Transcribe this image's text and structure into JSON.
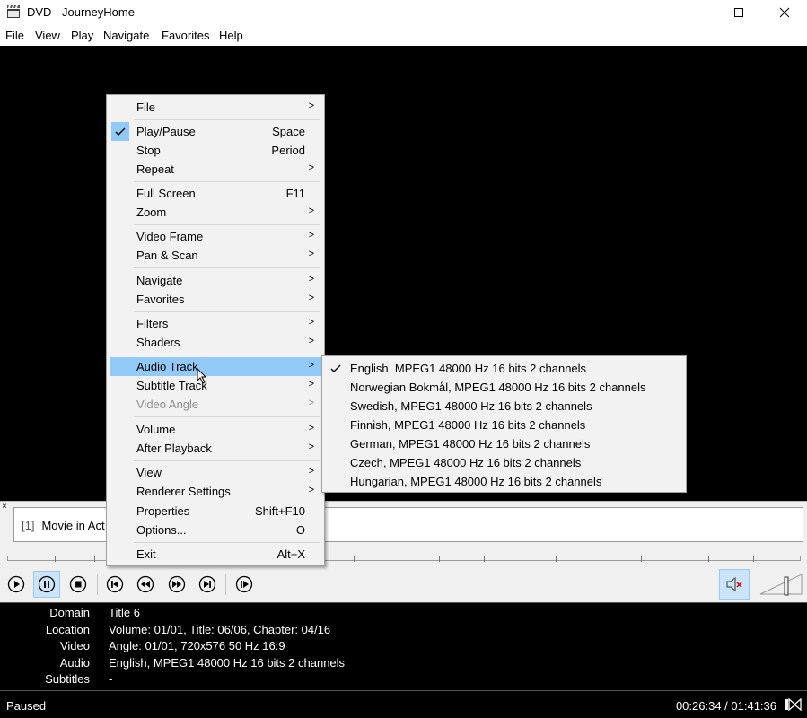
{
  "window": {
    "title": "DVD - JourneyHome"
  },
  "menubar": [
    "File",
    "View",
    "Play",
    "Navigate",
    "Favorites",
    "Help"
  ],
  "context_menu": {
    "items": [
      {
        "label": "File",
        "submenu": true
      },
      {
        "label": "Play/Pause",
        "shortcut": "Space",
        "checked": true
      },
      {
        "label": "Stop",
        "shortcut": "Period"
      },
      {
        "label": "Repeat",
        "submenu": true
      },
      {
        "label": "Full Screen",
        "shortcut": "F11"
      },
      {
        "label": "Zoom",
        "submenu": true
      },
      {
        "label": "Video Frame",
        "submenu": true
      },
      {
        "label": "Pan & Scan",
        "submenu": true
      },
      {
        "label": "Navigate",
        "submenu": true
      },
      {
        "label": "Favorites",
        "submenu": true
      },
      {
        "label": "Filters",
        "submenu": true
      },
      {
        "label": "Shaders",
        "submenu": true
      },
      {
        "label": "Audio Track",
        "submenu": true,
        "highlighted": true
      },
      {
        "label": "Subtitle Track",
        "submenu": true
      },
      {
        "label": "Video Angle",
        "submenu": true,
        "disabled": true
      },
      {
        "label": "Volume",
        "submenu": true
      },
      {
        "label": "After Playback",
        "submenu": true
      },
      {
        "label": "View",
        "submenu": true
      },
      {
        "label": "Renderer Settings",
        "submenu": true
      },
      {
        "label": "Properties",
        "shortcut": "Shift+F10"
      },
      {
        "label": "Options...",
        "shortcut": "O"
      },
      {
        "label": "Exit",
        "shortcut": "Alt+X"
      }
    ]
  },
  "audio_submenu": {
    "items": [
      {
        "label": "English, MPEG1 48000 Hz 16 bits 2 channels",
        "checked": true
      },
      {
        "label": "Norwegian Bokmål, MPEG1 48000 Hz 16 bits 2 channels"
      },
      {
        "label": "Swedish, MPEG1 48000 Hz 16 bits 2 channels"
      },
      {
        "label": "Finnish, MPEG1 48000 Hz 16 bits 2 channels"
      },
      {
        "label": "German, MPEG1 48000 Hz 16 bits 2 channels"
      },
      {
        "label": "Czech, MPEG1 48000 Hz 16 bits 2 channels"
      },
      {
        "label": "Hungarian, MPEG1 48000 Hz 16 bits 2 channels"
      }
    ]
  },
  "playlist": {
    "close": "×",
    "item_number": "[1]",
    "item_title": "Movie in Act"
  },
  "info": [
    {
      "label": "Domain",
      "value": "Title 6"
    },
    {
      "label": "Location",
      "value": "Volume: 01/01, Title: 06/06, Chapter: 04/16"
    },
    {
      "label": "Video",
      "value": "Angle: 01/01, 720x576 50 Hz 16:9"
    },
    {
      "label": "Audio",
      "value": "English, MPEG1 48000 Hz 16 bits 2 channels"
    },
    {
      "label": "Subtitles",
      "value": "-"
    }
  ],
  "status": {
    "state": "Paused",
    "time": "00:26:34 / 01:41:36"
  },
  "colors": {
    "highlight": "#91c9f7",
    "active_button": "#cce4f7"
  }
}
